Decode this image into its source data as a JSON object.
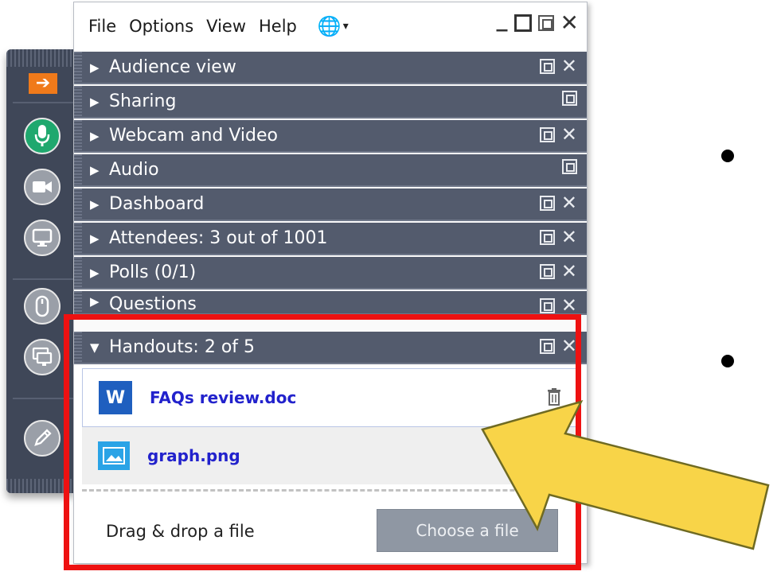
{
  "menu": {
    "items": [
      "File",
      "Options",
      "View",
      "Help"
    ],
    "language_icon": "globe-icon"
  },
  "panels": [
    {
      "title": "Audience view",
      "close": true
    },
    {
      "title": "Sharing",
      "close": false
    },
    {
      "title": "Webcam and Video",
      "close": true
    },
    {
      "title": "Audio",
      "close": false
    },
    {
      "title": "Dashboard",
      "close": true
    },
    {
      "title": "Attendees:  3 out of 1001",
      "close": true
    },
    {
      "title": "Polls (0/1)",
      "close": true
    },
    {
      "title": "Questions",
      "close": true
    }
  ],
  "handouts": {
    "title": "Handouts: 2 of 5",
    "files": [
      {
        "name": "FAQs review.doc",
        "icon": "word-doc-icon"
      },
      {
        "name": "graph.png",
        "icon": "image-file-icon"
      }
    ],
    "drop_text": "Drag & drop a file",
    "choose_button": "Choose a file"
  },
  "toolbar": {
    "buttons": [
      "arrow-collapse-icon",
      "microphone-icon",
      "webcam-icon",
      "screen-share-icon",
      "mouse-icon",
      "presenter-screen-icon",
      "pencil-icon"
    ]
  },
  "colors": {
    "panel_header": "#535b6d",
    "toolbar": "#3f4758",
    "mic_active": "#1fa86e",
    "arrow_button": "#f07a1a",
    "highlight_border": "#ee1111",
    "callout_arrow": "#f8d448",
    "file_link": "#2222cc"
  }
}
